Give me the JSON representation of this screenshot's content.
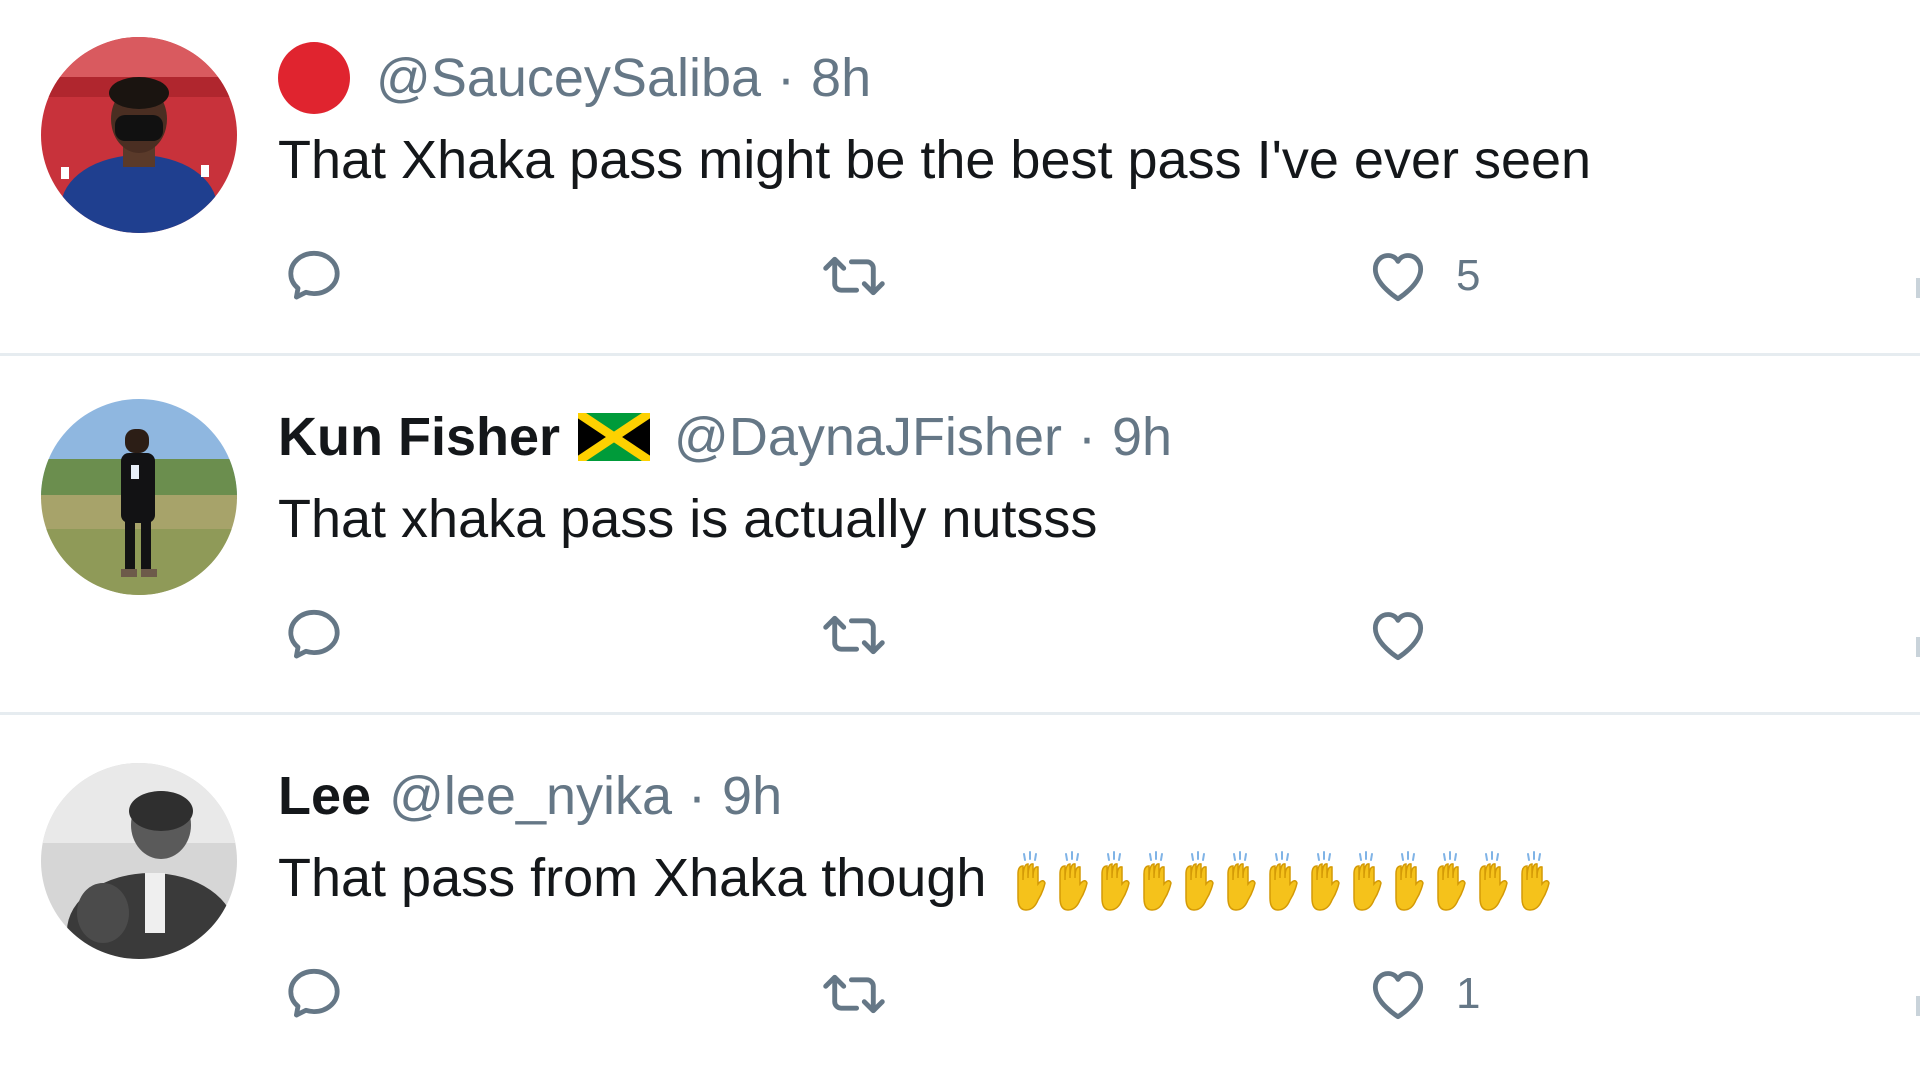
{
  "tweets": [
    {
      "display_name": "",
      "name_marker": "red-dot",
      "handle": "@SauceySaliba",
      "separator": "·",
      "time": "8h",
      "text": "That Xhaka pass might be the best pass I've ever seen",
      "like_count": "5",
      "avatar_icon": "user-avatar-red"
    },
    {
      "display_name": "Kun Fisher",
      "name_marker": "jamaica-flag-icon",
      "handle": "@DaynaJFisher",
      "separator": "·",
      "time": "9h",
      "text": "That xhaka pass is actually nutsss",
      "like_count": "",
      "avatar_icon": "user-avatar-field"
    },
    {
      "display_name": "Lee",
      "name_marker": "",
      "handle": "@lee_nyika",
      "separator": "·",
      "time": "9h",
      "text": "That pass from Xhaka though",
      "emoji": "🙌🙌🙌🙌🙌🙌🙌🙌🙌🙌🙌🙌🙌",
      "like_count": "1",
      "avatar_icon": "user-avatar-grey"
    }
  ],
  "colors": {
    "text": "#14171a",
    "muted": "#657786",
    "divider": "#e6ecf0",
    "red_dot": "#e0242f"
  },
  "icons": {
    "reply": "reply-icon",
    "retweet": "retweet-icon",
    "like": "heart-icon"
  }
}
